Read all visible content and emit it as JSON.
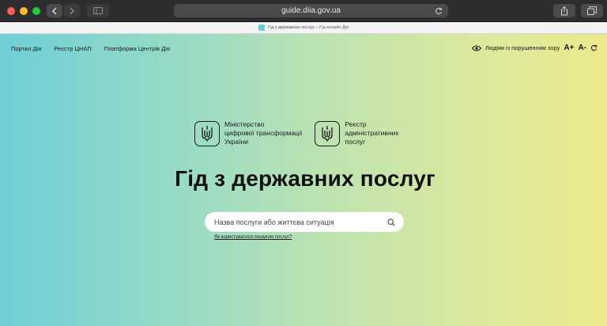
{
  "browser": {
    "url": "guide.diia.gov.ua",
    "tab_title": "Гід з державних послуг – Гід онлайн Дія"
  },
  "nav": {
    "items": [
      {
        "label": "Портал Дія"
      },
      {
        "label": "Реєстр ЦНАП"
      },
      {
        "label": "Платформа Центрів Дія"
      }
    ]
  },
  "accessibility": {
    "label": "Людям із порушенням зору",
    "increase": "A+",
    "decrease": "A-"
  },
  "logos": {
    "ministry": {
      "line1": "Міністерство",
      "line2": "цифрової трансформації",
      "line3": "України"
    },
    "registry": {
      "line1": "Реєстр",
      "line2": "адміністративних",
      "line3": "послуг"
    }
  },
  "main": {
    "title": "Гід з державних послуг",
    "search_placeholder": "Назва послуги або життєва ситуація",
    "help_link": "Як користуватися пошуком послуг?"
  },
  "colors": {
    "gradient_left": "#6fcfd6",
    "gradient_right": "#ece98c"
  }
}
